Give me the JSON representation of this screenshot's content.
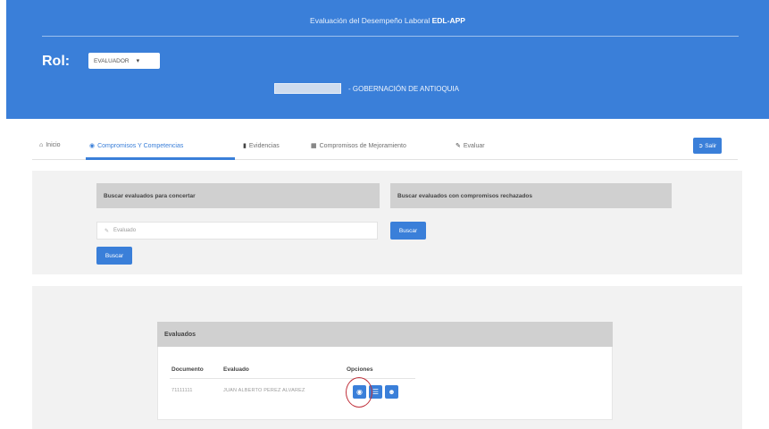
{
  "header": {
    "title_prefix": "Evaluación del Desempeño Laboral",
    "title_app": "EDL-APP",
    "rol_label": "Rol:",
    "rol_value": "EVALUADOR",
    "entity_name": "- GOBERNACIÓN DE ANTIOQUIA"
  },
  "nav": {
    "items": [
      {
        "label": "Inicio",
        "icon": "home-icon"
      },
      {
        "label": "Compromisos Y Competencias",
        "icon": "eye-icon"
      },
      {
        "label": "Evidencias",
        "icon": "file-icon"
      },
      {
        "label": "Compromisos de Mejoramiento",
        "icon": "table-icon"
      },
      {
        "label": "Evaluar",
        "icon": "edit-icon"
      }
    ],
    "active_index": 1,
    "exit_label": "Salir"
  },
  "search": {
    "left_header": "Buscar evaluados para concertar",
    "right_header": "Buscar evaluados con compromisos rechazados",
    "input_placeholder": "Evaluado",
    "left_button": "Buscar",
    "right_button": "Buscar"
  },
  "results": {
    "header": "Evaluados",
    "columns": [
      "Documento",
      "Evaluado",
      "Opciones"
    ],
    "rows": [
      {
        "documento": "71111111",
        "evaluado": "JUAN ALBERTO PEREZ ALVAREZ"
      }
    ]
  },
  "colors": {
    "primary": "#3a7fd9",
    "highlight_ring": "#c0303a"
  }
}
